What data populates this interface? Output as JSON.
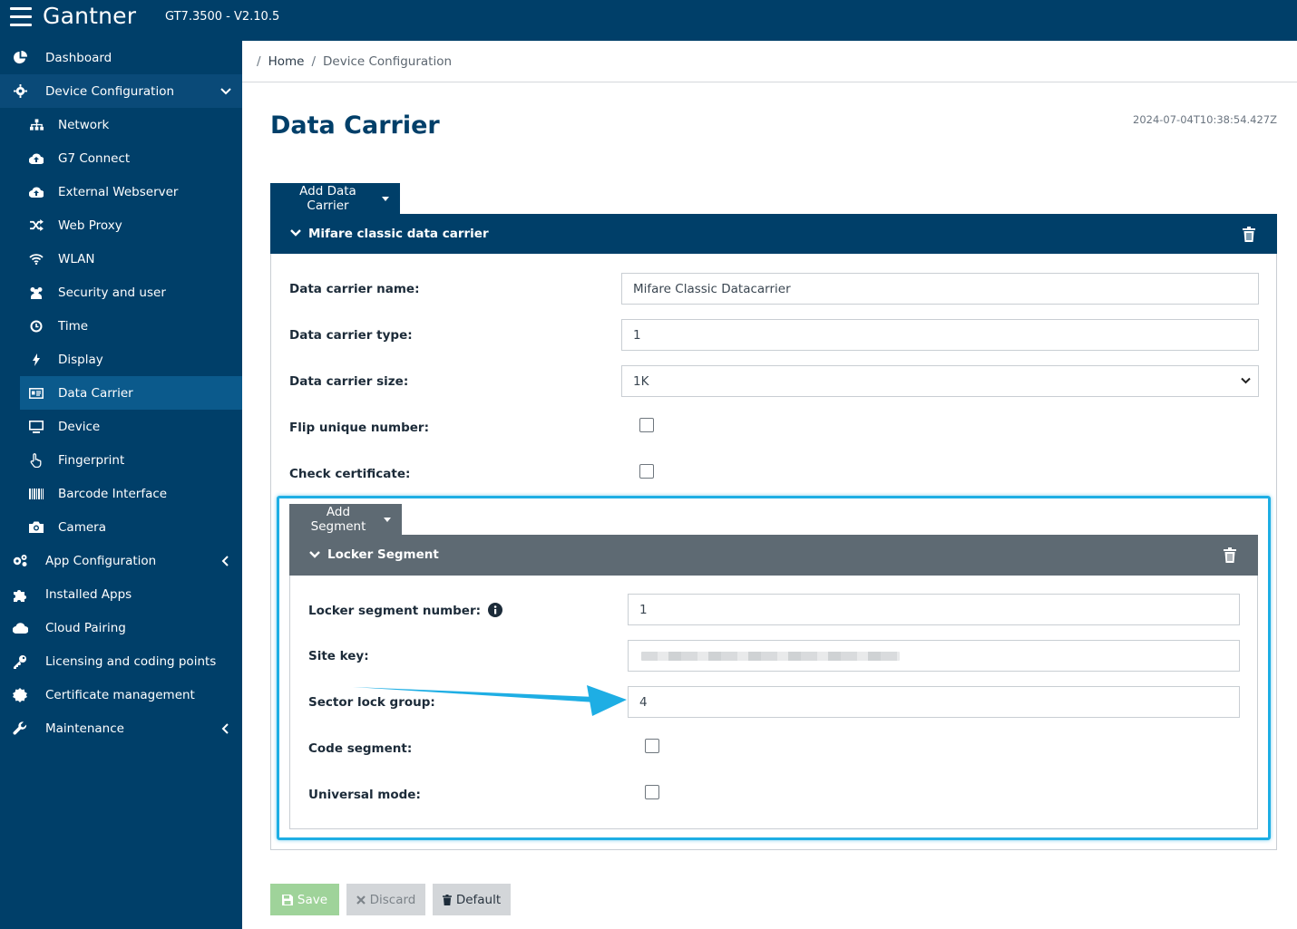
{
  "header": {
    "brand": "Gantner",
    "version": "GT7.3500 - V2.10.5"
  },
  "sidebar": {
    "items": [
      {
        "label": "Dashboard",
        "icon": "pie-chart-icon"
      },
      {
        "label": "Device Configuration",
        "icon": "gear-icon",
        "expanded": true
      },
      {
        "label": "Network",
        "icon": "network-icon"
      },
      {
        "label": "G7 Connect",
        "icon": "cloud-upload-icon"
      },
      {
        "label": "External Webserver",
        "icon": "cloud-upload-icon"
      },
      {
        "label": "Web Proxy",
        "icon": "shuffle-icon"
      },
      {
        "label": "WLAN",
        "icon": "wifi-icon"
      },
      {
        "label": "Security and user",
        "icon": "users-icon"
      },
      {
        "label": "Time",
        "icon": "clock-icon"
      },
      {
        "label": "Display",
        "icon": "bolt-icon"
      },
      {
        "label": "Data Carrier",
        "icon": "id-card-icon",
        "active": true
      },
      {
        "label": "Device",
        "icon": "monitor-icon"
      },
      {
        "label": "Fingerprint",
        "icon": "hand-pointer-icon"
      },
      {
        "label": "Barcode Interface",
        "icon": "barcode-icon"
      },
      {
        "label": "Camera",
        "icon": "camera-icon"
      },
      {
        "label": "App Configuration",
        "icon": "gears-icon"
      },
      {
        "label": "Installed Apps",
        "icon": "puzzle-icon"
      },
      {
        "label": "Cloud Pairing",
        "icon": "cloud-icon"
      },
      {
        "label": "Licensing and coding points",
        "icon": "key-icon"
      },
      {
        "label": "Certificate management",
        "icon": "certificate-icon"
      },
      {
        "label": "Maintenance",
        "icon": "wrench-icon"
      }
    ]
  },
  "breadcrumb": {
    "home": "Home",
    "current": "Device Configuration"
  },
  "page": {
    "title": "Data Carrier",
    "timestamp": "2024-07-04T10:38:54.427Z",
    "add_carrier_label": "Add Data Carrier"
  },
  "carrier": {
    "header": "Mifare classic data carrier",
    "name_label": "Data carrier name:",
    "name_value": "Mifare Classic Datacarrier",
    "type_label": "Data carrier type:",
    "type_value": "1",
    "size_label": "Data carrier size:",
    "size_value": "1K",
    "flip_label": "Flip unique number:",
    "flip_checked": false,
    "cert_label": "Check certificate:",
    "cert_checked": false
  },
  "segment": {
    "add_label": "Add Segment",
    "header": "Locker Segment",
    "number_label": "Locker segment number:",
    "number_value": "1",
    "sitekey_label": "Site key:",
    "lockgroup_label": "Sector lock group:",
    "lockgroup_value": "4",
    "code_label": "Code segment:",
    "code_checked": false,
    "universal_label": "Universal mode:",
    "universal_checked": false
  },
  "actions": {
    "save": "Save",
    "discard": "Discard",
    "default": "Default"
  },
  "colors": {
    "primary": "#003f69",
    "active": "#0b5a8c",
    "segment": "#5e6a73",
    "highlight": "#1eaee4",
    "save": "#9fd39a"
  }
}
